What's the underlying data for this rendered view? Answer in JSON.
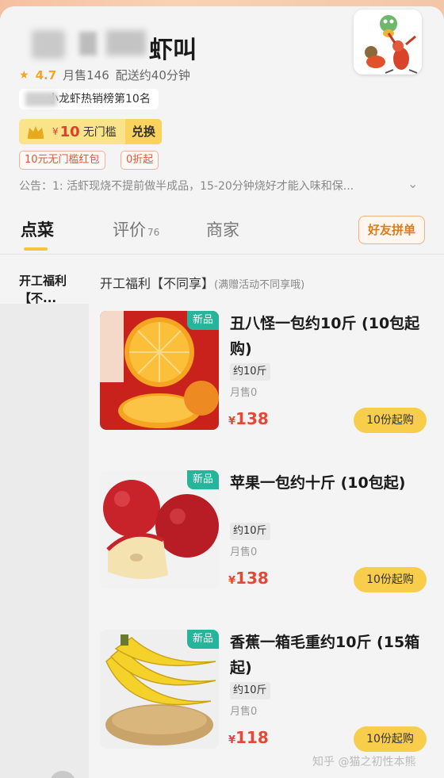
{
  "store": {
    "name_suffix": "虾叫",
    "rating": "4.7",
    "monthly_sales": "月售146",
    "delivery": "配送约40分钟",
    "rank": "小龙虾热销榜第10名"
  },
  "coupon": {
    "yen": "¥",
    "amount": "10",
    "text": "无门槛",
    "redeem": "兑换"
  },
  "tags": [
    "10元无门槛红包",
    "0折起"
  ],
  "notice": "公告：1: 活虾现烧不提前做半成品，15-20分钟烧好才能入味和保...",
  "tabs": {
    "order": "点菜",
    "reviews": "评价",
    "reviews_count": "76",
    "merchant": "商家",
    "group_buy": "好友拼单"
  },
  "sidebar": {
    "active_label": "开工福利【不..."
  },
  "section": {
    "title": "开工福利【不同享】",
    "subtitle": "(满赠活动不同享哦)"
  },
  "products": [
    {
      "badge": "新品",
      "name": "丑八怪一包约10斤 (10包起购)",
      "weight": "约10斤",
      "sales": "月售0",
      "yen": "¥",
      "price": "138",
      "button": "10份起购",
      "image": "orange"
    },
    {
      "badge": "新品",
      "name": "苹果一包约十斤 (10包起)",
      "weight": "约10斤",
      "sales": "月售0",
      "yen": "¥",
      "price": "138",
      "button": "10份起购",
      "image": "apple"
    },
    {
      "badge": "新品",
      "name": "香蕉一箱毛重约10斤 (15箱起)",
      "weight": "约10斤",
      "sales": "月售0",
      "yen": "¥",
      "price": "118",
      "button": "10份起购",
      "image": "banana"
    }
  ],
  "watermark": "知乎 @猫之初性本熊",
  "colors": {
    "accent_yellow": "#f7cd4b",
    "price_red": "#e54836",
    "badge_green": "#26b59a"
  }
}
